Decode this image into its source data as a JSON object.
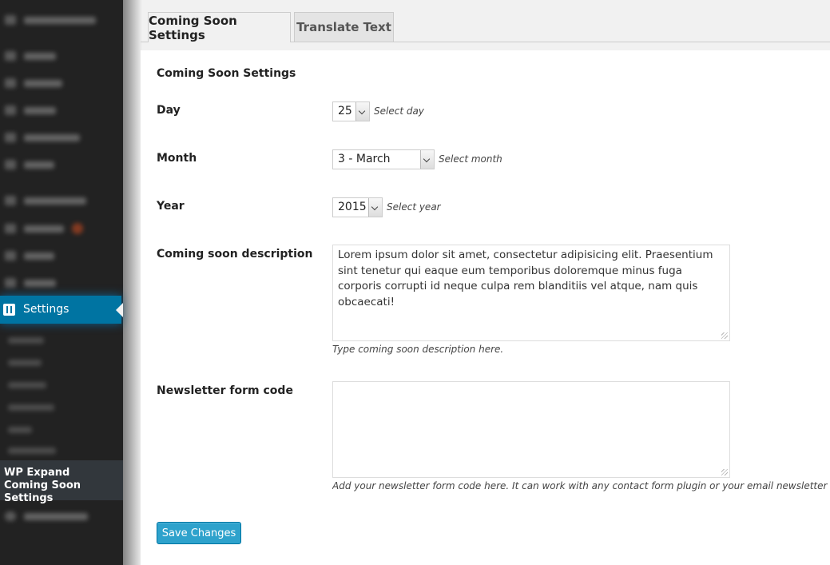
{
  "sidebar": {
    "active_item": "Settings",
    "plugin_item": "WP Expand Coming Soon Settings",
    "active_color": "#0074a2"
  },
  "tabs": [
    {
      "label": "Coming Soon Settings",
      "active": true
    },
    {
      "label": "Translate Text",
      "active": false
    }
  ],
  "form": {
    "section_title": "Coming Soon Settings",
    "day": {
      "label": "Day",
      "value": "25",
      "hint": "Select day"
    },
    "month": {
      "label": "Month",
      "value": "3 - March",
      "hint": "Select month"
    },
    "year": {
      "label": "Year",
      "value": "2015",
      "hint": "Select year"
    },
    "description": {
      "label": "Coming soon description",
      "value": "Lorem ipsum dolor sit amet, consectetur adipisicing elit. Praesentium sint tenetur qui eaque eum temporibus doloremque minus fuga corporis corrupti id neque culpa rem blanditiis vel atque, nam quis obcaecati!",
      "hint": "Type coming soon description here."
    },
    "newsletter": {
      "label": "Newsletter form code",
      "value": "",
      "hint": "Add your newsletter form code here. It can work with any contact form plugin or your email newsletter provid"
    },
    "save_label": "Save Changes",
    "button_color": "#2ea2cc"
  }
}
